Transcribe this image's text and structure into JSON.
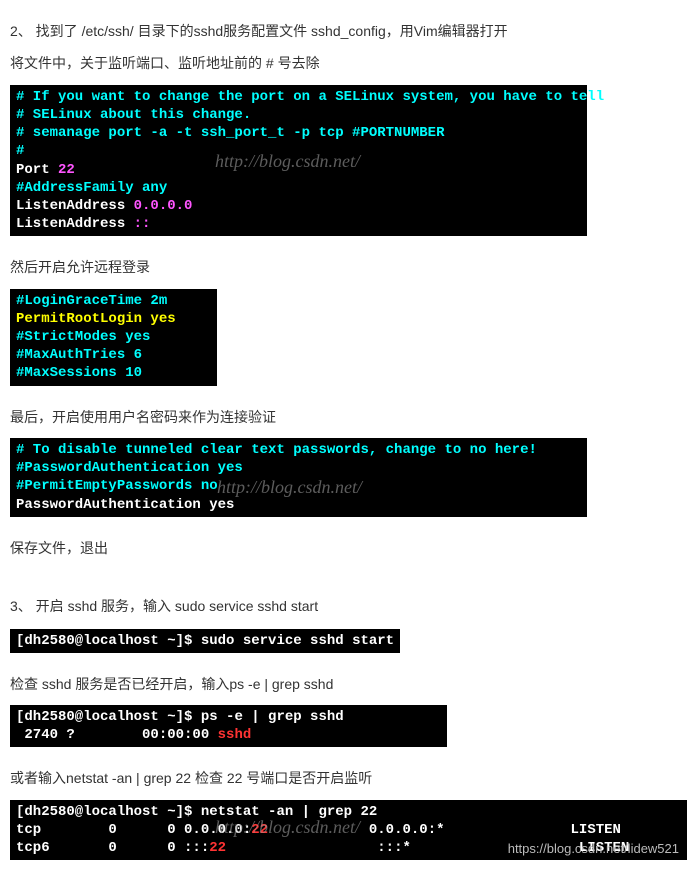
{
  "step2Title": "2、 找到了 /etc/ssh/ 目录下的sshd服务配置文件 sshd_config，用Vim编辑器打开",
  "step2Sub": "将文件中，关于监听端口、监听地址前的 # 号去除",
  "block1": {
    "l1": "# If you want to change the port on a SELinux system, you have to tell",
    "l2": "# SELinux about this change.",
    "l3": "# semanage port -a -t ssh_port_t -p tcp #PORTNUMBER",
    "l4": "#",
    "l5a": "Port ",
    "l5b": "22",
    "l6": "#AddressFamily any",
    "l7a": "ListenAddress ",
    "l7b": "0.0.0.0",
    "l8a": "ListenAddress ",
    "l8b": "::"
  },
  "step2Sub2": "然后开启允许远程登录",
  "block2": {
    "l1": "#LoginGraceTime 2m",
    "l2": "PermitRootLogin yes",
    "l3": "#StrictModes yes",
    "l4": "#MaxAuthTries 6",
    "l5": "#MaxSessions 10"
  },
  "step2Sub3": "最后，开启使用用户名密码来作为连接验证",
  "block3": {
    "l1": "# To disable tunneled clear text passwords, change to no here!",
    "l2": "#PasswordAuthentication yes",
    "l3": "#PermitEmptyPasswords no",
    "l4": "PasswordAuthentication yes"
  },
  "step2Sub4": "保存文件，退出",
  "step3Title": "3、 开启 sshd 服务，输入 sudo service sshd start",
  "block4": {
    "prompt": "[dh2580@localhost ~]$ ",
    "cmd": "sudo service sshd start"
  },
  "step3Sub1": "检查 sshd 服务是否已经开启，输入ps -e | grep sshd",
  "block5": {
    "prompt": "[dh2580@localhost ~]$ ",
    "cmd": "ps -e | grep sshd",
    "out1": " 2740 ?        00:00:00 ",
    "out1b": "sshd"
  },
  "step3Sub2": "或者输入netstat -an | grep 22 检查 22 号端口是否开启监听",
  "block6": {
    "prompt": "[dh2580@localhost ~]$ ",
    "cmd": "netstat -an | grep 22",
    "r1a": "tcp        0      0 0.0.0.0:",
    "r1b": "22",
    "r1c": "            0.0.0.0:*               LISTEN",
    "r2a": "tcp6       0      0 :::",
    "r2b": "22",
    "r2c": "                  :::*                    LISTEN"
  },
  "watermarkText": "http://blog.csdn.net/",
  "footerWm": "https://blog.csdn.net/lidew521"
}
